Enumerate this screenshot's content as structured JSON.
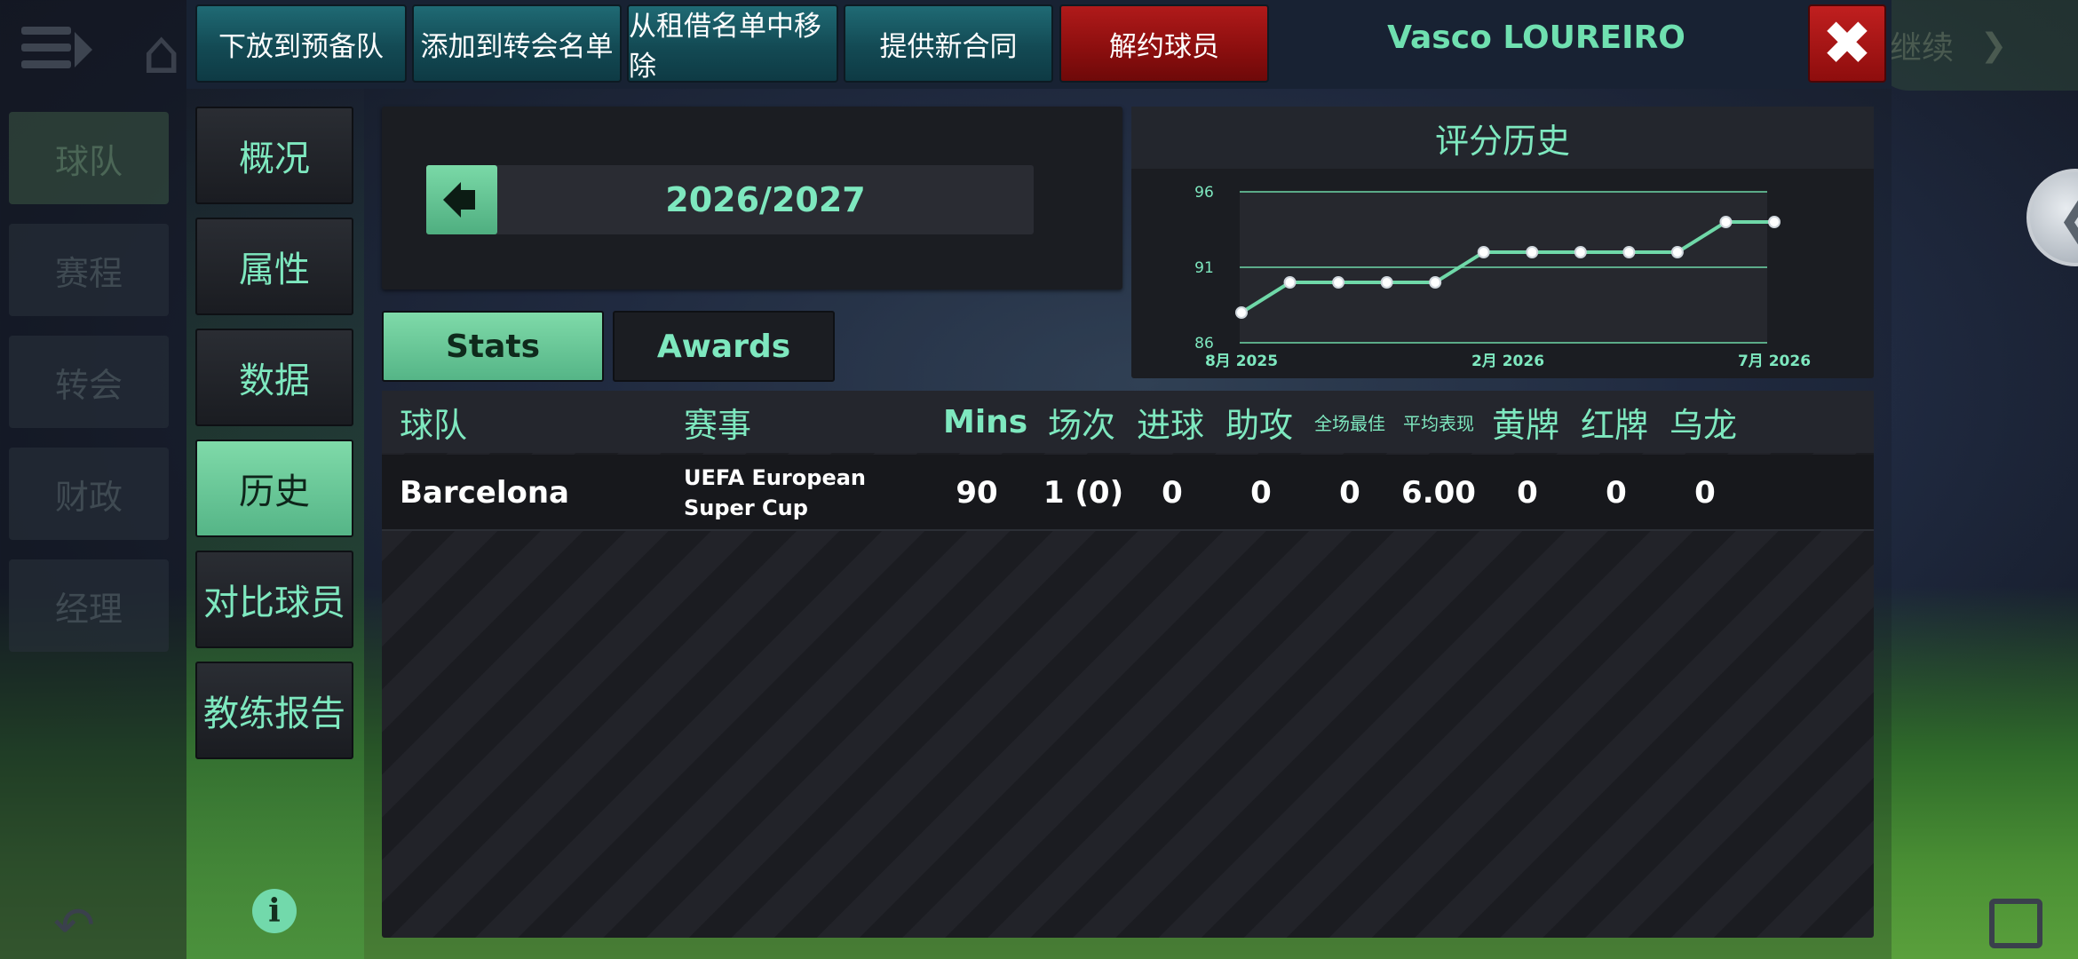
{
  "background_app": {
    "nav_items": [
      "球队",
      "赛程",
      "转会",
      "财政",
      "经理"
    ],
    "continue_label": "继续"
  },
  "toolbar": {
    "actions": [
      {
        "label": "下放到预备队"
      },
      {
        "label": "添加到转会名单"
      },
      {
        "label": "从租借名单中移除"
      },
      {
        "label": "提供新合同"
      },
      {
        "label": "解约球员"
      }
    ],
    "player_name": "Vasco LOUREIRO"
  },
  "side_tabs": [
    "概况",
    "属性",
    "数据",
    "历史",
    "对比球员",
    "教练报告"
  ],
  "season": {
    "label": "2026/2027"
  },
  "view_tabs": {
    "stats": "Stats",
    "awards": "Awards"
  },
  "rating_history": {
    "title": "评分历史"
  },
  "chart_data": {
    "type": "line",
    "y_ticks": [
      86,
      91,
      96
    ],
    "x_ticks": [
      "8月 2025",
      "2月 2026",
      "7月 2026"
    ],
    "ylim": [
      86,
      96
    ],
    "values": [
      88,
      90,
      90,
      90,
      90,
      92,
      92,
      92,
      92,
      92,
      94,
      94
    ],
    "grid": true,
    "color": "#6fd8a8"
  },
  "table": {
    "headers": {
      "team": "球队",
      "competition": "赛事",
      "mins": "Mins",
      "apps": "场次",
      "goals": "进球",
      "assists": "助攻",
      "motm": "全场最佳",
      "avg_rating": "平均表现",
      "yellow": "黄牌",
      "red": "红牌",
      "own_goals": "乌龙"
    },
    "rows": [
      {
        "team": "Barcelona",
        "competition": "UEFA European Super Cup",
        "mins": "90",
        "apps": "1 (0)",
        "goals": "0",
        "assists": "0",
        "motm": "0",
        "avg_rating": "6.00",
        "yellow": "0",
        "red": "0",
        "own_goals": "0"
      }
    ]
  },
  "colors": {
    "accent": "#7ee8bf",
    "danger": "#a01414",
    "teal_button": "#17545e"
  }
}
